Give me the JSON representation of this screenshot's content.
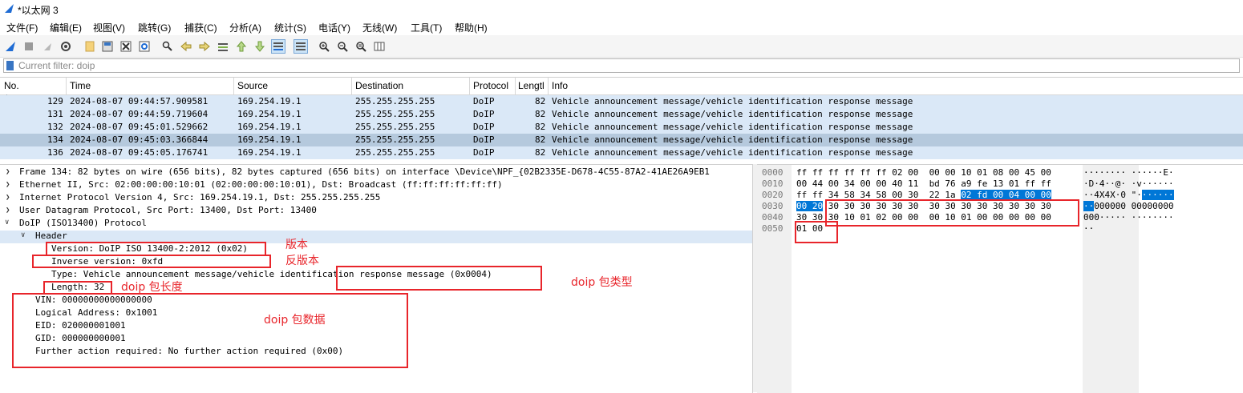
{
  "window": {
    "title": "*以太网 3"
  },
  "menu": [
    "文件(F)",
    "编辑(E)",
    "视图(V)",
    "跳转(G)",
    "捕获(C)",
    "分析(A)",
    "统计(S)",
    "电话(Y)",
    "无线(W)",
    "工具(T)",
    "帮助(H)"
  ],
  "toolbar_icons": [
    "shark-fin-start-icon",
    "stop-icon",
    "restart-icon",
    "capture-options-icon",
    "open-file-icon",
    "save-file-icon",
    "close-file-icon",
    "reload-icon",
    "find-icon",
    "back-icon",
    "forward-icon",
    "goto-packet-icon",
    "first-packet-icon",
    "last-packet-icon",
    "autoscroll-icon",
    "colorize-icon",
    "zoom-in-icon",
    "zoom-out-icon",
    "normal-size-icon",
    "resize-columns-icon"
  ],
  "filter": {
    "placeholder": "Current filter: doip",
    "value": ""
  },
  "packet_list": {
    "columns": [
      "No.",
      "Time",
      "Source",
      "Destination",
      "Protocol",
      "Lengtl",
      "Info"
    ],
    "rows": [
      {
        "no": "129",
        "time": "2024-08-07 09:44:57.909581",
        "source": "169.254.19.1",
        "destination": "255.255.255.255",
        "protocol": "DoIP",
        "length": "82",
        "info": "Vehicle announcement message/vehicle identification response message"
      },
      {
        "no": "131",
        "time": "2024-08-07 09:44:59.719604",
        "source": "169.254.19.1",
        "destination": "255.255.255.255",
        "protocol": "DoIP",
        "length": "82",
        "info": "Vehicle announcement message/vehicle identification response message"
      },
      {
        "no": "132",
        "time": "2024-08-07 09:45:01.529662",
        "source": "169.254.19.1",
        "destination": "255.255.255.255",
        "protocol": "DoIP",
        "length": "82",
        "info": "Vehicle announcement message/vehicle identification response message"
      },
      {
        "no": "134",
        "time": "2024-08-07 09:45:03.366844",
        "source": "169.254.19.1",
        "destination": "255.255.255.255",
        "protocol": "DoIP",
        "length": "82",
        "info": "Vehicle announcement message/vehicle identification response message"
      },
      {
        "no": "136",
        "time": "2024-08-07 09:45:05.176741",
        "source": "169.254.19.1",
        "destination": "255.255.255.255",
        "protocol": "DoIP",
        "length": "82",
        "info": "Vehicle announcement message/vehicle identification response message"
      }
    ]
  },
  "details": {
    "frame": "Frame 134: 82 bytes on wire (656 bits), 82 bytes captured (656 bits) on interface \\Device\\NPF_{02B2335E-D678-4C55-87A2-41AE26A9EB1",
    "ethernet": "Ethernet II, Src: 02:00:00:00:10:01 (02:00:00:00:10:01), Dst: Broadcast (ff:ff:ff:ff:ff:ff)",
    "ip": "Internet Protocol Version 4, Src: 169.254.19.1, Dst: 255.255.255.255",
    "udp": "User Datagram Protocol, Src Port: 13400, Dst Port: 13400",
    "doip": "DoIP (ISO13400) Protocol",
    "header": "Header",
    "version": "Version: DoIP ISO 13400-2:2012 (0x02)",
    "inverse_version": "Inverse version: 0xfd",
    "type": "Type: Vehicle announcement message/vehicle identification response message (0x0004)",
    "length": "Length: 32",
    "vin": "VIN: 00000000000000000",
    "logical_address": "Logical Address: 0x1001",
    "eid": "EID: 020000001001",
    "gid": "GID: 000000000001",
    "further_action": "Further action required: No further action required (0x00)"
  },
  "bytes": {
    "offsets": [
      "0000",
      "0010",
      "0020",
      "0030",
      "0040",
      "0050"
    ],
    "hex": {
      "r0": "ff ff ff ff ff ff 02 00  00 00 10 01 08 00 45 00",
      "r1": "00 44 00 34 00 00 40 11  bd 76 a9 fe 13 01 ff ff",
      "r2a": "ff ff 34 58 34 58 00 30  22 1a ",
      "r2b": "02 fd 00 04 00 00",
      "r3a": "00 20",
      "r3b": " 30 30 30 30 30 30  30 30 30 30 30 30 30 30",
      "r4": "30 30 30 10 01 02 00 00  00 10 01 00 00 00 00 00",
      "r5": "01 00"
    },
    "ascii": {
      "r0": "········ ······E·",
      "r1": "·D·4··@· ·v······",
      "r2a": "··4X4X·0 \"·",
      "r2b": "······",
      "r3a": "··",
      "r3b": "000000 00000000",
      "r4": "000····· ········",
      "r5": "··"
    }
  },
  "annotations": {
    "version": "版本",
    "inverse_version": "反版本",
    "type": "doip 包类型",
    "length": "doip 包长度",
    "data": "doip 包数据"
  },
  "colors": {
    "row_bg": "#dae8f7",
    "selected_row": "#b5c9dd",
    "highlight": "#0077d7",
    "annotation": "#e8252b"
  }
}
